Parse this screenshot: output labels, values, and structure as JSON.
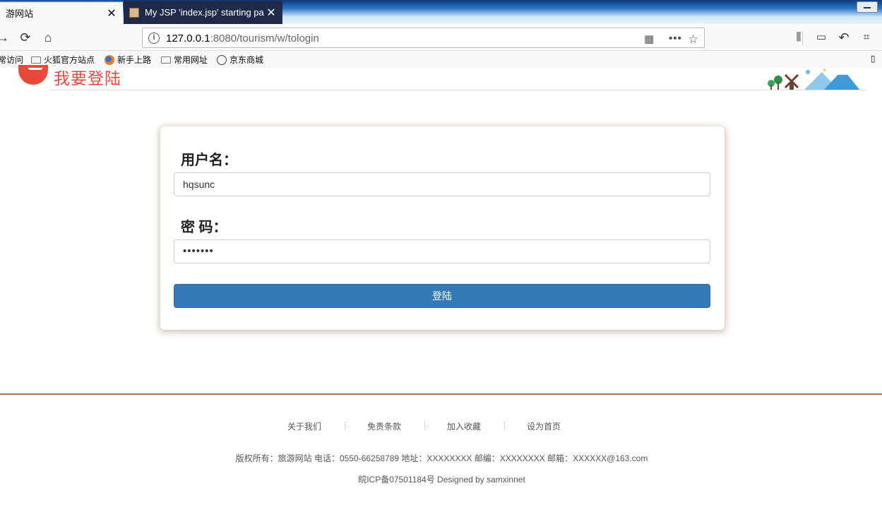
{
  "browser": {
    "tabs": [
      {
        "label": "游网站",
        "active": true
      },
      {
        "label": "My JSP 'index.jsp' starting pa",
        "active": false
      }
    ],
    "url": {
      "host": "127.0.0.1",
      "rest": ":8080/tourism/w/tologin"
    },
    "bookmarks": [
      "常访问",
      "火狐官方站点",
      "新手上路",
      "常用网址",
      "京东商城"
    ],
    "toolbar_right": [
      "library-icon",
      "sidebar-icon",
      "undo-icon",
      "screenshot-icon"
    ],
    "accent_color": "#0a84ff"
  },
  "header": {
    "title": "我要登陆",
    "brand_color": "#e9483b"
  },
  "login": {
    "username_label": "用户名：",
    "username_value": "hqsunc",
    "password_label": "密 码：",
    "password_value": "•••••••",
    "submit_label": "登陆",
    "button_color": "#337ab7"
  },
  "footer": {
    "links": [
      "关于我们",
      "免责条款",
      "加入收藏",
      "设为首页"
    ],
    "copyright": "版权所有：旅游网站 电话：0550-66258789 地址：XXXXXXXX 邮编：XXXXXXXX 邮箱：XXXXXX@163.com",
    "icp": "皖ICP备07501184号 Designed by samxinnet"
  }
}
